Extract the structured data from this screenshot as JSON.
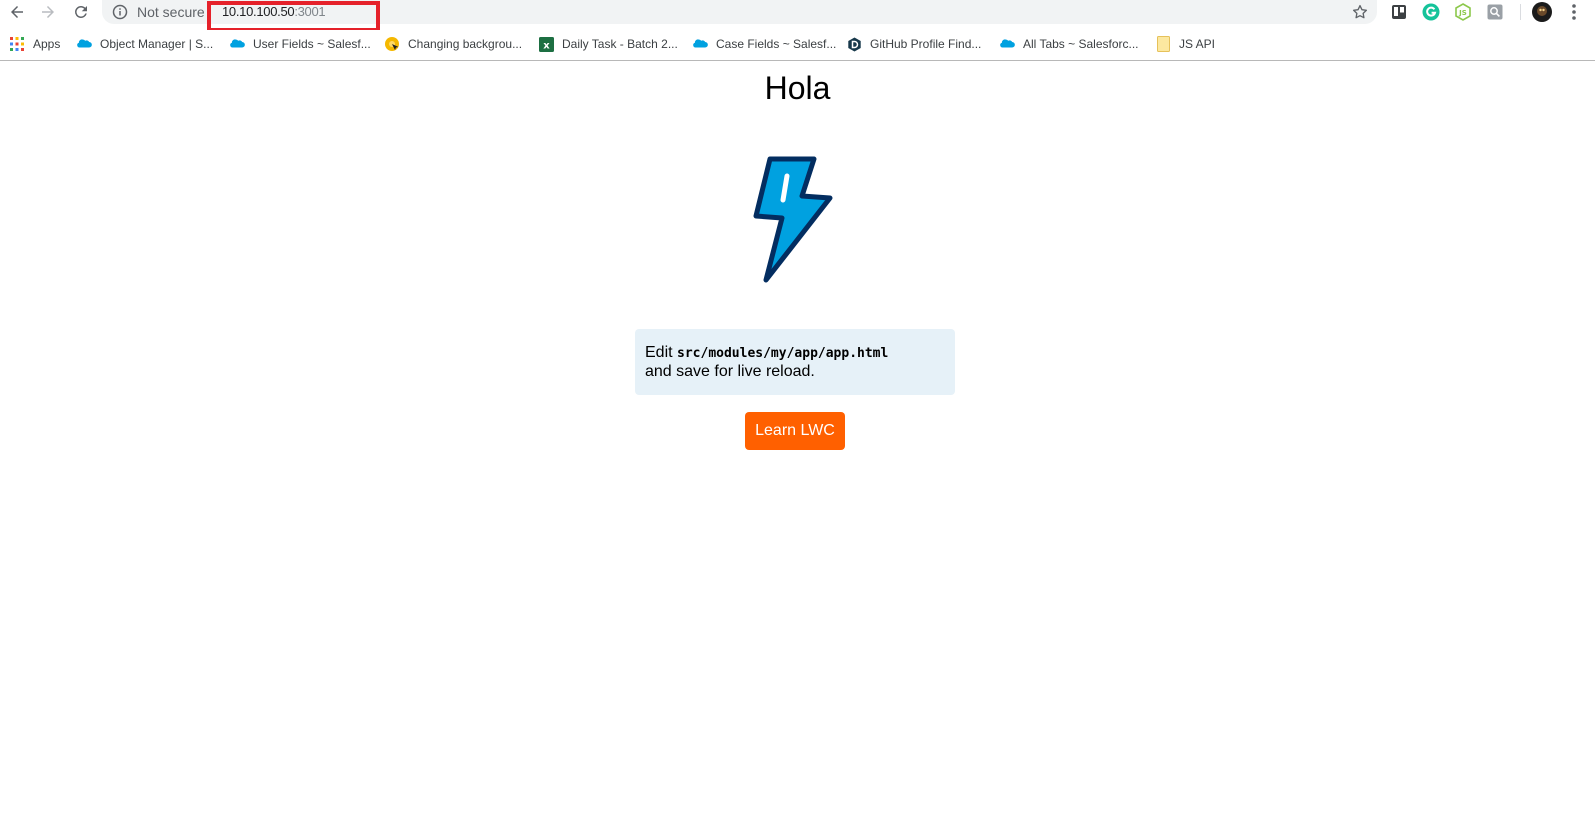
{
  "browser": {
    "security_label": "Not secure",
    "url_host": "10.10.100.50",
    "url_port": ":3001"
  },
  "bookmarks": [
    {
      "label": "Apps",
      "icon": "apps-grid-icon"
    },
    {
      "label": "Object Manager | S...",
      "icon": "salesforce-cloud-icon"
    },
    {
      "label": "User Fields ~ Salesf...",
      "icon": "salesforce-cloud-icon"
    },
    {
      "label": "Changing backgrou...",
      "icon": "yellow-circle-icon"
    },
    {
      "label": "Daily Task - Batch 2...",
      "icon": "excel-icon"
    },
    {
      "label": "Case Fields ~ Salesf...",
      "icon": "salesforce-cloud-icon"
    },
    {
      "label": "GitHub Profile Find...",
      "icon": "d-logo-icon"
    },
    {
      "label": "All Tabs ~ Salesforc...",
      "icon": "salesforce-cloud-icon"
    },
    {
      "label": "JS API",
      "icon": "folder-icon"
    }
  ],
  "page": {
    "title": "Hola",
    "edit_prefix": "Edit ",
    "edit_path": "src/modules/my/app/app.html",
    "edit_suffix": "and save for live reload.",
    "button_label": "Learn LWC"
  },
  "colors": {
    "accent_button": "#ff6000",
    "info_box_bg": "#e6f1f8",
    "bolt_fill": "#00a1e0",
    "bolt_outline": "#032d60",
    "highlight": "#e5212a"
  }
}
